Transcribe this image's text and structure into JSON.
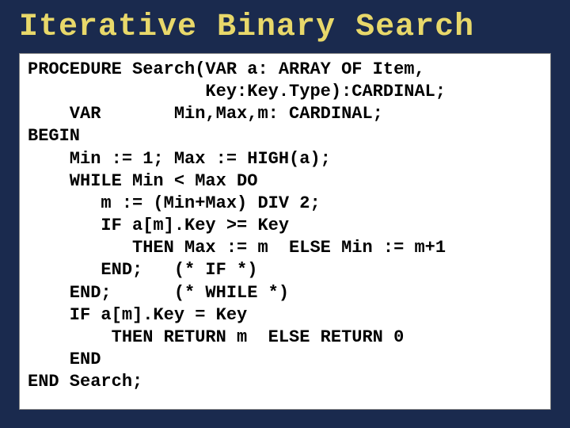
{
  "title": "Iterative Binary Search",
  "code": {
    "l01": "PROCEDURE Search(VAR a: ARRAY OF Item,",
    "l02": "                 Key:Key.Type):CARDINAL;",
    "l03": "    VAR       Min,Max,m: CARDINAL;",
    "l04": "BEGIN",
    "l05": "    Min := 1; Max := HIGH(a);",
    "l06": "    WHILE Min < Max DO",
    "l07": "       m := (Min+Max) DIV 2;",
    "l08": "       IF a[m].Key >= Key",
    "l09": "          THEN Max := m  ELSE Min := m+1",
    "l10": "       END;   (* IF *)",
    "l11": "    END;      (* WHILE *)",
    "l12": "    IF a[m].Key = Key",
    "l13": "        THEN RETURN m  ELSE RETURN 0",
    "l14": "    END",
    "l15": "END Search;"
  }
}
